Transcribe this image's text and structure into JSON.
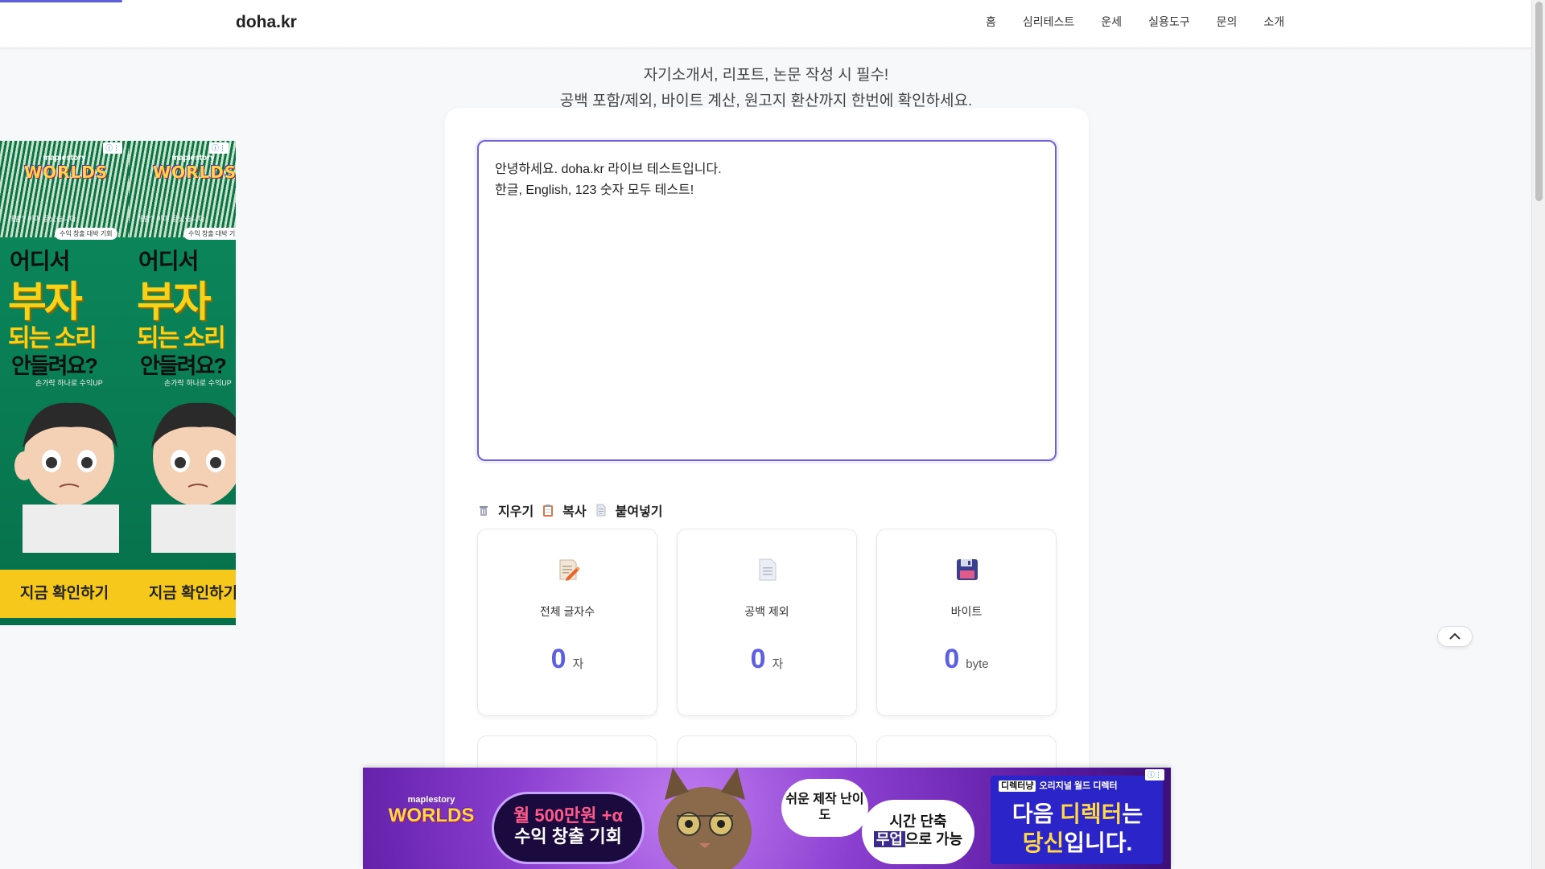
{
  "header": {
    "logo": "doha.kr",
    "nav": [
      {
        "label": "홈",
        "name": "nav-home"
      },
      {
        "label": "심리테스트",
        "name": "nav-psych-test"
      },
      {
        "label": "운세",
        "name": "nav-fortune"
      },
      {
        "label": "실용도구",
        "name": "nav-tools"
      },
      {
        "label": "문의",
        "name": "nav-contact"
      },
      {
        "label": "소개",
        "name": "nav-about"
      }
    ]
  },
  "intro": {
    "line1": "자기소개서, 리포트, 논문 작성 시 필수!",
    "line2": "공백 포함/제외, 바이트 계산, 원고지 환산까지 한번에 확인하세요."
  },
  "editor": {
    "value": "안녕하세요. doha.kr 라이브 테스트입니다.\n한글, English, 123 숫자 모두 테스트!"
  },
  "actions": {
    "clear": "지우기",
    "copy": "복사",
    "paste": "붙여넣기"
  },
  "stats": [
    {
      "title": "전체 글자수",
      "value": "0",
      "unit": "자",
      "icon": "memo-pencil-icon"
    },
    {
      "title": "공백 제외",
      "value": "0",
      "unit": "자",
      "icon": "document-icon"
    },
    {
      "title": "바이트",
      "value": "0",
      "unit": "byte",
      "icon": "floppy-disk-icon"
    }
  ],
  "ads": {
    "left": {
      "brand_small": "maplestory",
      "brand": "WORLDS",
      "small_text": "개발? 이미 끝났습니다.",
      "pill": "수익 창출 대박 기회",
      "line1": "어디서",
      "line2": "부자",
      "line3": "되는 소리",
      "line4": "안들려요?",
      "sub": "손가락 하나로 수익UP",
      "cta": "지금 확인하기"
    },
    "bottom": {
      "brand_small": "maplestory",
      "brand": "WORLDS",
      "bubble1_a": "월 500만원 +α",
      "bubble1_b": "수익 창출 기회",
      "bubble2": "쉬운 제작 난이도",
      "bubble3_a": "시간 단축",
      "bubble3_b": "무업",
      "bubble3_c": "으로 가능",
      "tag_a": "디렉터냥",
      "tag_b": "오리지널 월드 디렉터",
      "main_a": "다음 ",
      "main_hl": "디렉터",
      "main_b": "는",
      "main_c": "당신",
      "main_d": "입니다."
    }
  },
  "colors": {
    "accent": "#5b5fe0",
    "border_focus": "#6d5fd8",
    "background": "#f7f8fa"
  }
}
